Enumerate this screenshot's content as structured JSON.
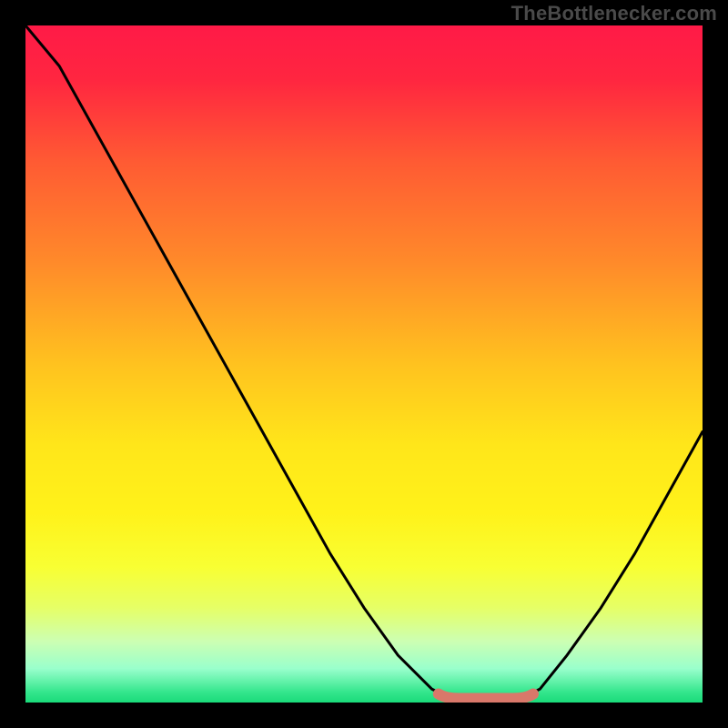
{
  "watermark": "TheBottlenecker.com",
  "chart_data": {
    "type": "line",
    "title": "",
    "xlabel": "",
    "ylabel": "",
    "xlim": [
      0,
      100
    ],
    "ylim": [
      0,
      100
    ],
    "x": [
      0,
      5,
      10,
      15,
      20,
      25,
      30,
      35,
      40,
      45,
      50,
      55,
      60,
      62,
      64,
      66,
      68,
      70,
      72,
      74,
      76,
      80,
      85,
      90,
      95,
      100
    ],
    "values": [
      100,
      94,
      85,
      76,
      67,
      58,
      49,
      40,
      31,
      22,
      14,
      7,
      2,
      1,
      0.5,
      0.5,
      0.5,
      0.5,
      0.7,
      1,
      2,
      7,
      14,
      22,
      31,
      40
    ],
    "highlight_x_range": [
      61,
      75
    ],
    "gradient_stops": [
      {
        "offset": 0.0,
        "color": "#ff1a47"
      },
      {
        "offset": 0.08,
        "color": "#ff2640"
      },
      {
        "offset": 0.2,
        "color": "#ff5a33"
      },
      {
        "offset": 0.35,
        "color": "#ff8a2a"
      },
      {
        "offset": 0.5,
        "color": "#ffc21f"
      },
      {
        "offset": 0.62,
        "color": "#ffe61a"
      },
      {
        "offset": 0.72,
        "color": "#fff21a"
      },
      {
        "offset": 0.8,
        "color": "#f8ff33"
      },
      {
        "offset": 0.86,
        "color": "#e6ff66"
      },
      {
        "offset": 0.91,
        "color": "#ccffb3"
      },
      {
        "offset": 0.95,
        "color": "#99ffcc"
      },
      {
        "offset": 0.985,
        "color": "#33e68c"
      },
      {
        "offset": 1.0,
        "color": "#1adb7a"
      }
    ],
    "curve_color": "#000000",
    "highlight_color": "#d9786a"
  }
}
